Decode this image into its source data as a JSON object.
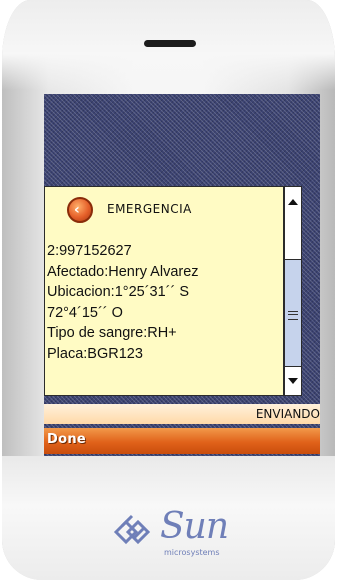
{
  "alert": {
    "title": "EMERGENCIA",
    "icon": "back-arrow-icon",
    "lines": [
      "2:997152627",
      "Afectado:Henry Alvarez",
      "Ubicacion:1°25´31´´ S",
      "72°4´15´´ O",
      "Tipo de sangre:RH+",
      "Placa:BGR123"
    ]
  },
  "status": {
    "text": "ENVIANDO"
  },
  "softkeys": {
    "left": "Done"
  },
  "branding": {
    "logo": "Sun",
    "subtitle": "microsystems"
  },
  "colors": {
    "screen_bg": "#3c4372",
    "alert_bg": "#fffbc4",
    "softkey_bar": "#e0621a",
    "logo": "#6f7fb8"
  }
}
